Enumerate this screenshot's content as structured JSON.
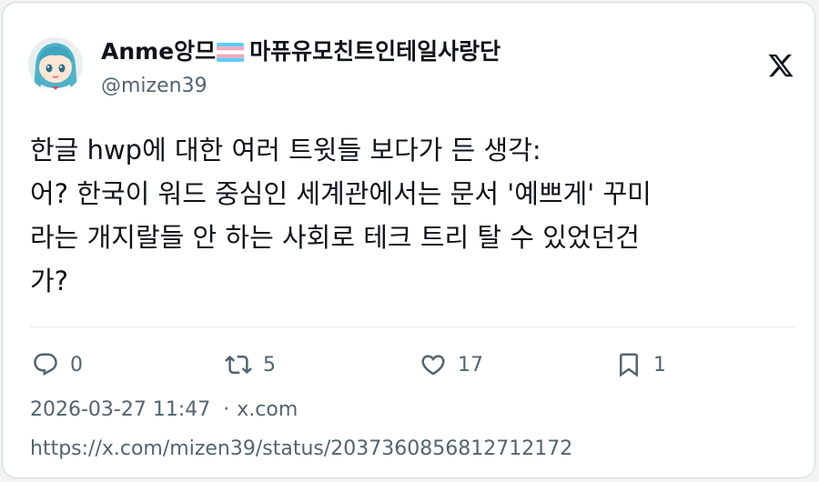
{
  "author": {
    "display_name": "Anme앙므",
    "display_name_suffix": "마퓨유모친트인테일사랑단",
    "handle": "@mizen39",
    "flag_icon": "transgender-flag-emoji"
  },
  "tweet": {
    "lines": [
      "한글 hwp에 대한 여러 트윗들 보다가 든 생각:",
      "어? 한국이 워드 중심인 세계관에서는 문서 '예쁘게' 꾸미",
      "라는 개지랄들 안 하는 사회로 테크 트리 탈 수 있었던건",
      "가?"
    ]
  },
  "actions": {
    "reply_count": "0",
    "retweet_count": "5",
    "like_count": "17",
    "bookmark_count": "1"
  },
  "meta": {
    "timestamp": "2026-03-27 11:47",
    "separator": "·",
    "source": "x.com",
    "url": "https://x.com/mizen39/status/2037360856812712172"
  },
  "colors": {
    "text_primary": "#0f1419",
    "text_secondary": "#536471",
    "border": "#cfd9de",
    "flag_blue": "#5bcefa",
    "flag_pink": "#f5a9b8",
    "flag_white": "#ffffff"
  }
}
